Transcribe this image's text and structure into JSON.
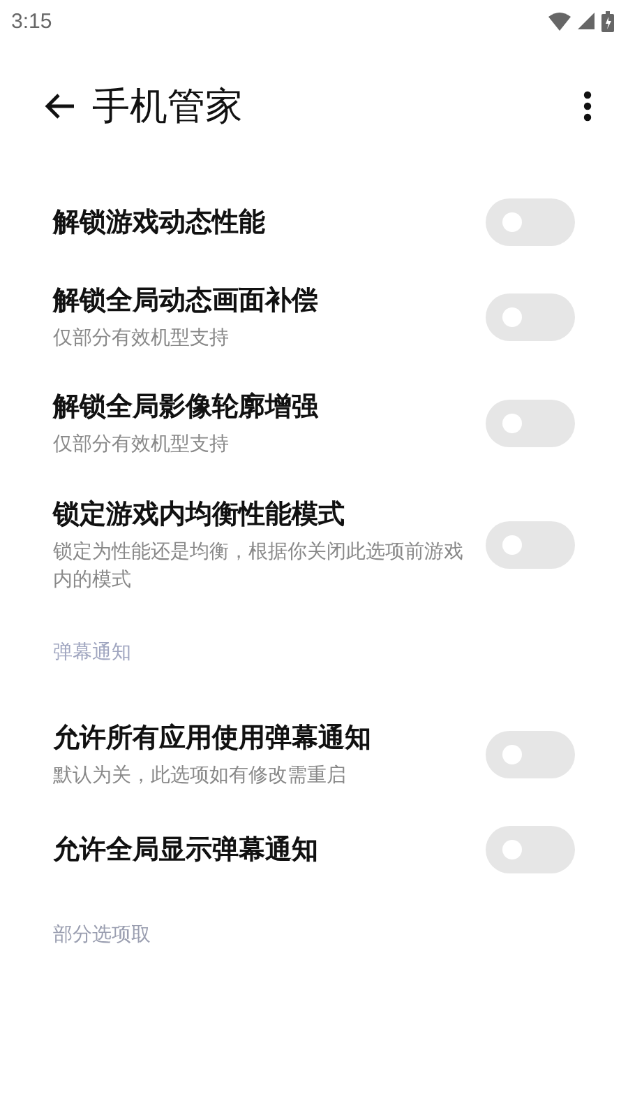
{
  "status_bar": {
    "time": "3:15"
  },
  "toolbar": {
    "title": "手机管家"
  },
  "items": [
    {
      "kind": "switch",
      "title": "解锁游戏动态性能",
      "on": false
    },
    {
      "kind": "switch",
      "title": "解锁全局动态画面补偿",
      "summary": "仅部分有效机型支持",
      "on": false
    },
    {
      "kind": "switch",
      "title": "解锁全局影像轮廓增强",
      "summary": "仅部分有效机型支持",
      "on": false
    },
    {
      "kind": "switch",
      "title": "锁定游戏内均衡性能模式",
      "summary": "锁定为性能还是均衡，根据你关闭此选项前游戏内的模式",
      "on": false
    },
    {
      "kind": "header",
      "title": "弹幕通知"
    },
    {
      "kind": "switch",
      "title": "允许所有应用使用弹幕通知",
      "summary": "默认为关，此选项如有修改需重启",
      "on": false
    },
    {
      "kind": "switch",
      "title": "允许全局显示弹幕通知",
      "on": false
    },
    {
      "kind": "note",
      "title": "部分选项取"
    }
  ]
}
